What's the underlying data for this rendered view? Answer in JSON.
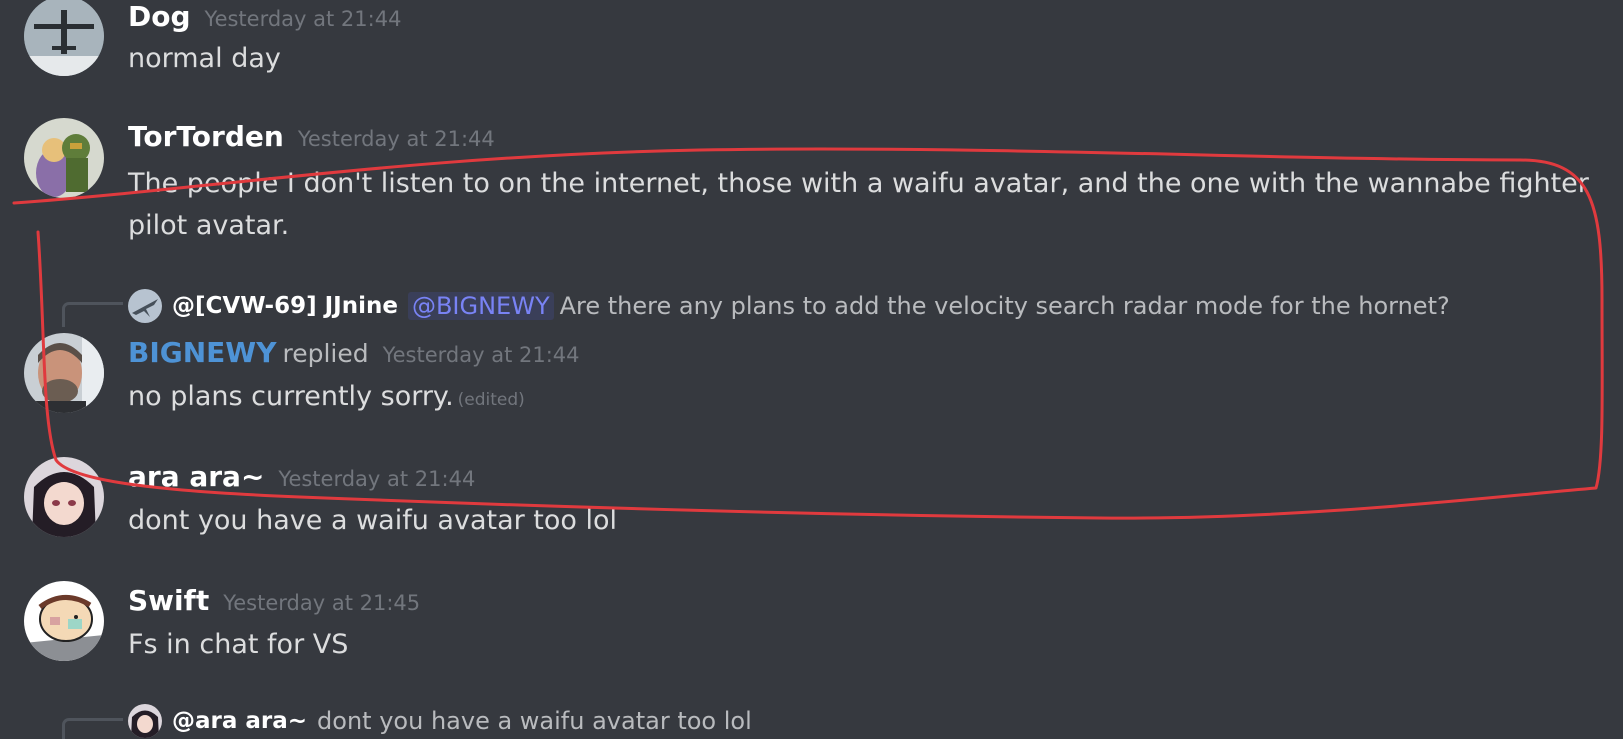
{
  "messages": [
    {
      "id": "dog",
      "username": "Dog",
      "timestamp": "Yesterday at 21:44",
      "content": "normal day"
    },
    {
      "id": "tortorden",
      "username": "TorTorden",
      "timestamp": "Yesterday at 21:44",
      "content": "The people I don't listen to on the internet, those with a waifu avatar, and the one with the wannabe fighter pilot avatar."
    },
    {
      "id": "bignewy",
      "username": "BIGNEWY",
      "replied_label": "replied",
      "timestamp": "Yesterday at 21:44",
      "content": "no plans currently sorry.",
      "edited_label": "(edited)",
      "reply": {
        "user": "@[CVW-69] JJnine",
        "mention": "@BIGNEWY",
        "text": "Are there any plans to add the velocity search radar mode for the hornet?"
      }
    },
    {
      "id": "ara",
      "username": "ara ara~",
      "timestamp": "Yesterday at 21:44",
      "content": "dont you have a waifu avatar too lol"
    },
    {
      "id": "swift",
      "username": "Swift",
      "timestamp": "Yesterday at 21:45",
      "content": "Fs in chat for VS"
    },
    {
      "id": "next",
      "reply": {
        "user": "@ara ara~",
        "text": "dont you have a waifu avatar too lol"
      }
    }
  ],
  "colors": {
    "background": "#36393f",
    "username": "#ffffff",
    "role_blue": "#4e93d6",
    "timestamp": "#72767d",
    "message_text": "#dcddde",
    "annotation_red": "#e03a3e"
  },
  "icons": {
    "dog_avatar": "aircraft-avatar-icon",
    "tortorden_avatar": "soldier-avatar-icon",
    "bignewy_avatar": "person-avatar-icon",
    "ara_avatar": "anime-girl-avatar-icon",
    "swift_avatar": "cartoon-avatar-icon",
    "jjnine_avatar": "jet-avatar-icon"
  }
}
